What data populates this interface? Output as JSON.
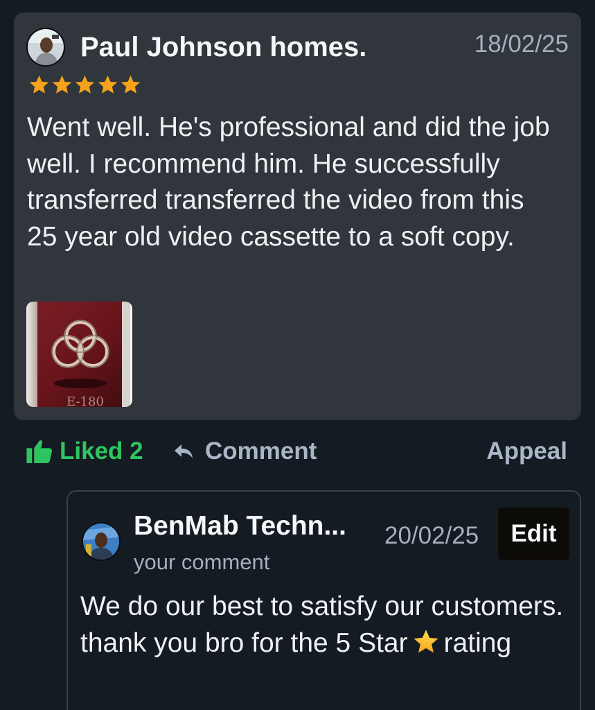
{
  "review": {
    "reviewer_name": "Paul Johnson homes.",
    "date": "18/02/25",
    "rating": 5,
    "star_color": "#f6a31b",
    "text": "Went well. He's professional and did the job well. I recommend him. He successfully transferred transferred the video from this 25 year old video cassette to a soft copy.",
    "avatar_icon": "user-avatar-photo",
    "photo_icon": "video-cassette-photo"
  },
  "actions": {
    "like_label": "Liked 2",
    "like_icon": "thumbs-up-icon",
    "like_color": "#2ec561",
    "comment_label": "Comment",
    "comment_icon": "reply-arrow-icon",
    "appeal_label": "Appeal"
  },
  "reply": {
    "business_name": "BenMab Techn...",
    "subtitle": "your comment",
    "date": "20/02/25",
    "edit_label": "Edit",
    "text_before": "We do our best to satisfy our customers. thank you bro for the 5 Star",
    "text_after": "rating",
    "avatar_icon": "business-avatar-photo"
  },
  "colors": {
    "background": "#151b22",
    "card": "#30363c",
    "muted_text": "#a4b0bf"
  }
}
